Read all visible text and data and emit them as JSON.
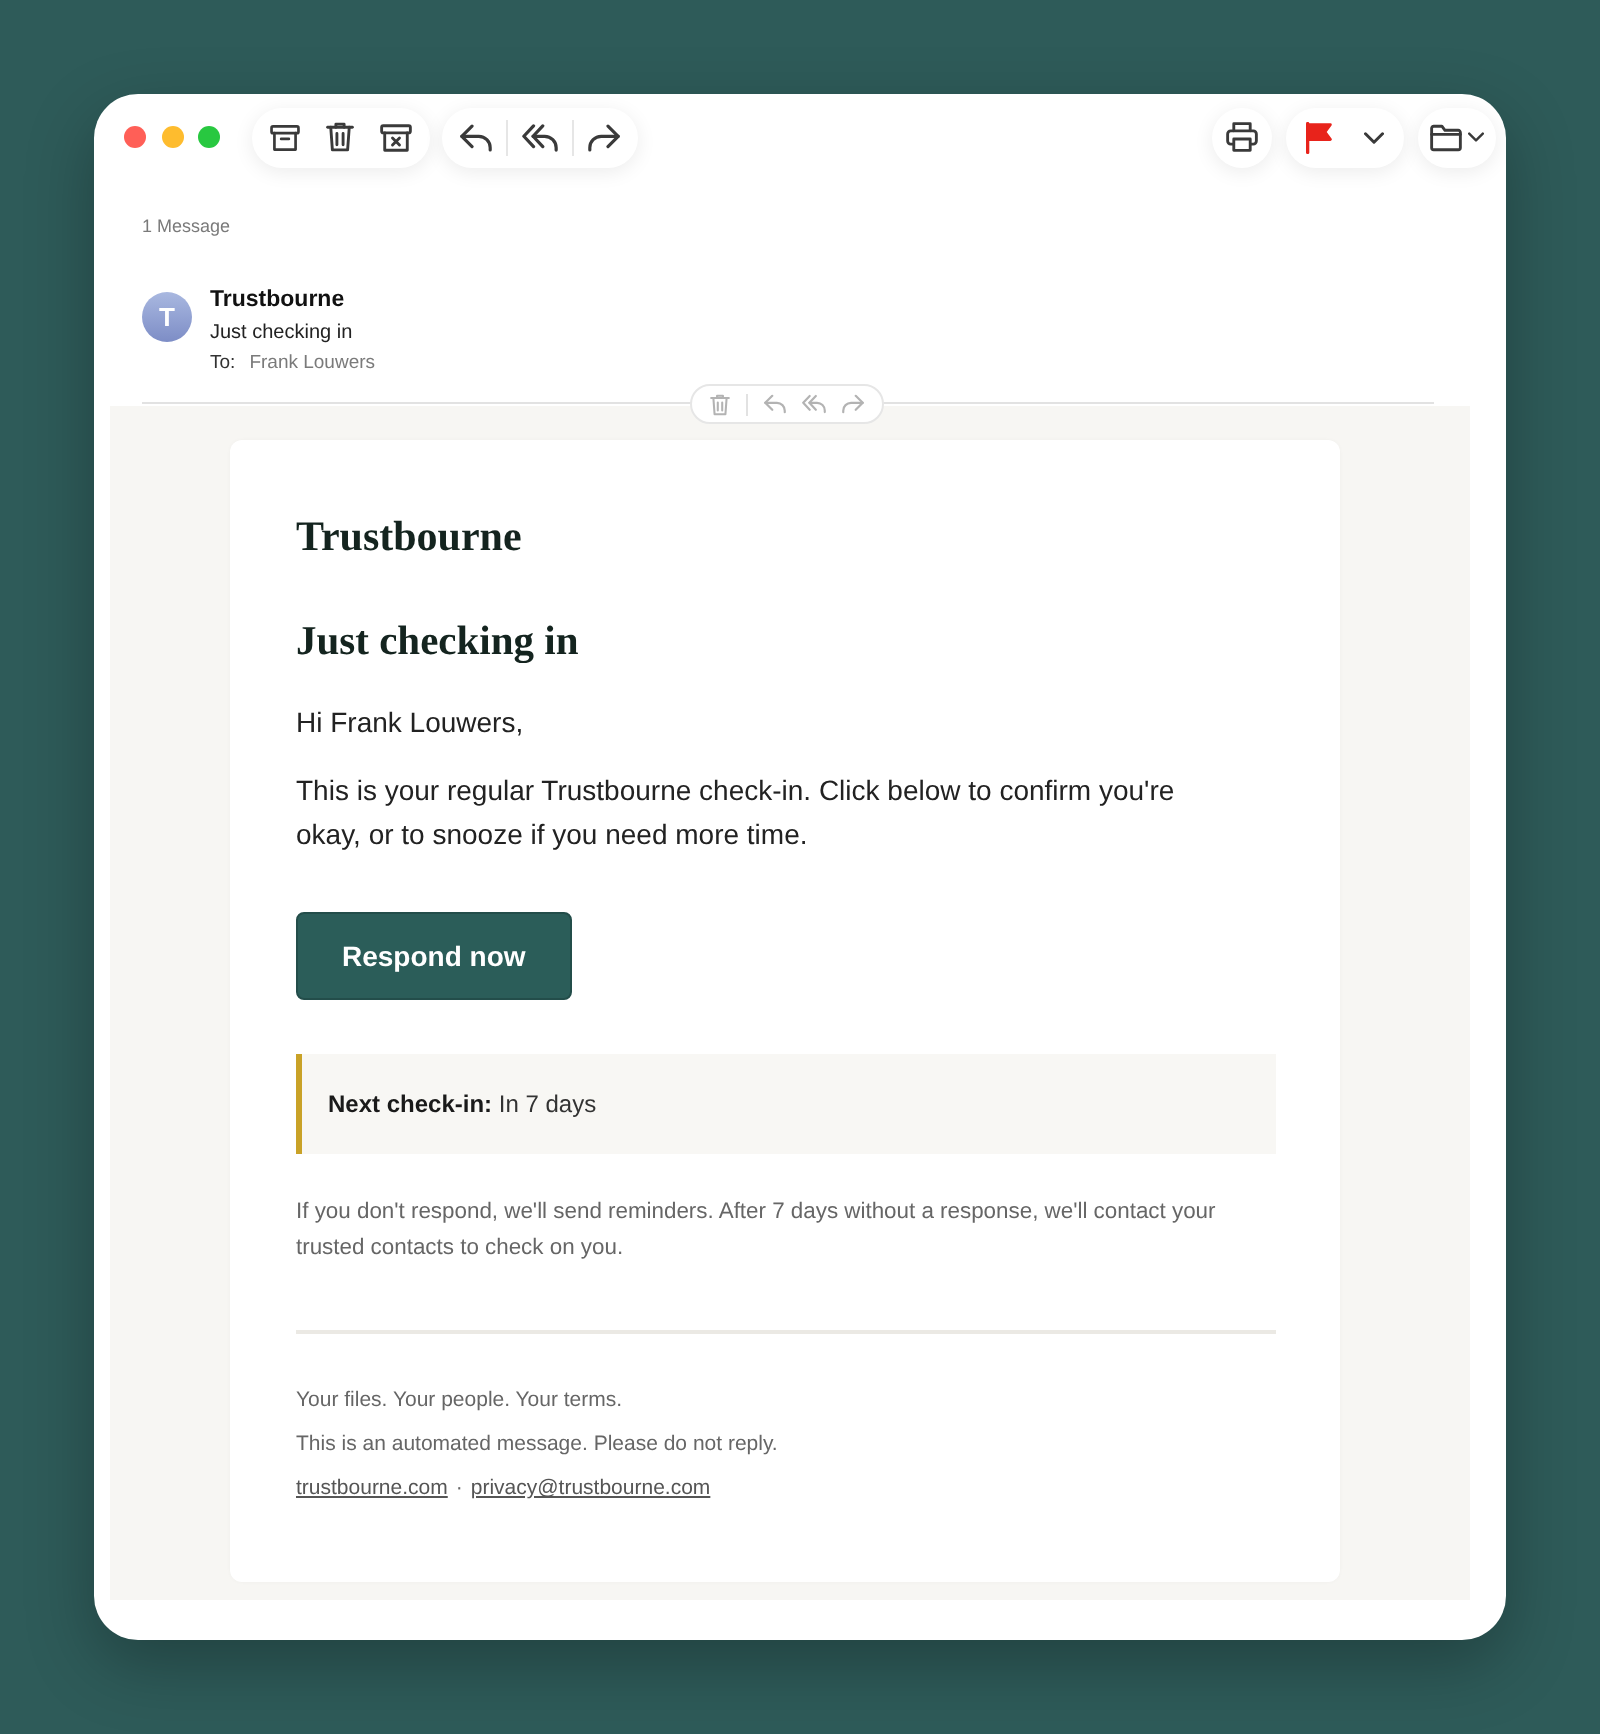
{
  "window": {
    "message_count": "1 Message"
  },
  "message": {
    "avatar_initial": "T",
    "sender": "Trustbourne",
    "subject": "Just checking in",
    "to_label": "To:",
    "recipient": "Frank Louwers"
  },
  "email": {
    "brand": "Trustbourne",
    "heading": "Just checking in",
    "greeting": "Hi Frank Louwers,",
    "intro": "This is your regular Trustbourne check-in. Click below to confirm you're okay, or to snooze if you need more time.",
    "button": "Respond now",
    "callout": "**Next check-in:** In 7 days",
    "notice": "If you don't respond, we'll send reminders. After 7 days without a response, we'll contact your trusted contacts to check on you.",
    "footer": {
      "tagline": "Your files. Your people. Your terms.",
      "disclaimer": "This is an automated message. Please do not reply.",
      "links": [
        "trustbourne.com",
        "privacy@trustbourne.com"
      ],
      "separator": "·"
    }
  }
}
